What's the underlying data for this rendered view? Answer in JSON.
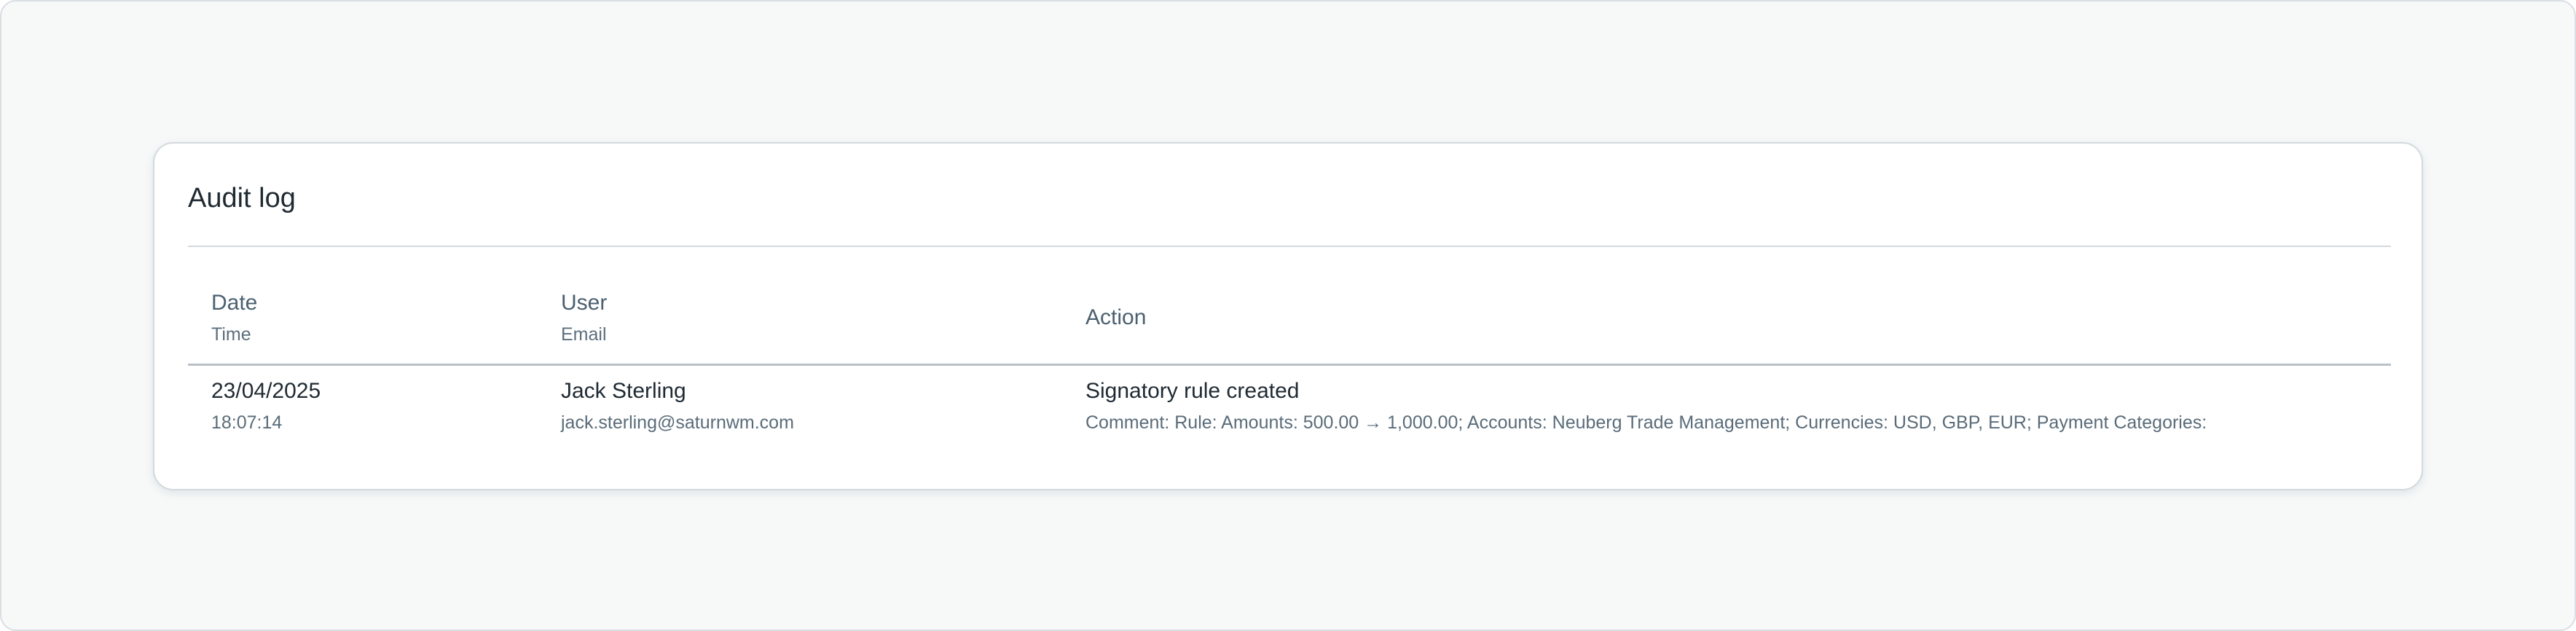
{
  "audit_log": {
    "title": "Audit log",
    "columns": {
      "date": {
        "label": "Date",
        "sublabel": "Time"
      },
      "user": {
        "label": "User",
        "sublabel": "Email"
      },
      "action": {
        "label": "Action"
      }
    },
    "rows": [
      {
        "date": "23/04/2025",
        "time": "18:07:14",
        "user_name": "Jack Sterling",
        "user_email": "jack.sterling@saturnwm.com",
        "action": "Signatory rule created",
        "comment": "Comment: Rule: Amounts: 500.00 → 1,000.00; Accounts: Neuberg Trade Management; Currencies: USD, GBP, EUR; Payment Categories:"
      }
    ]
  }
}
